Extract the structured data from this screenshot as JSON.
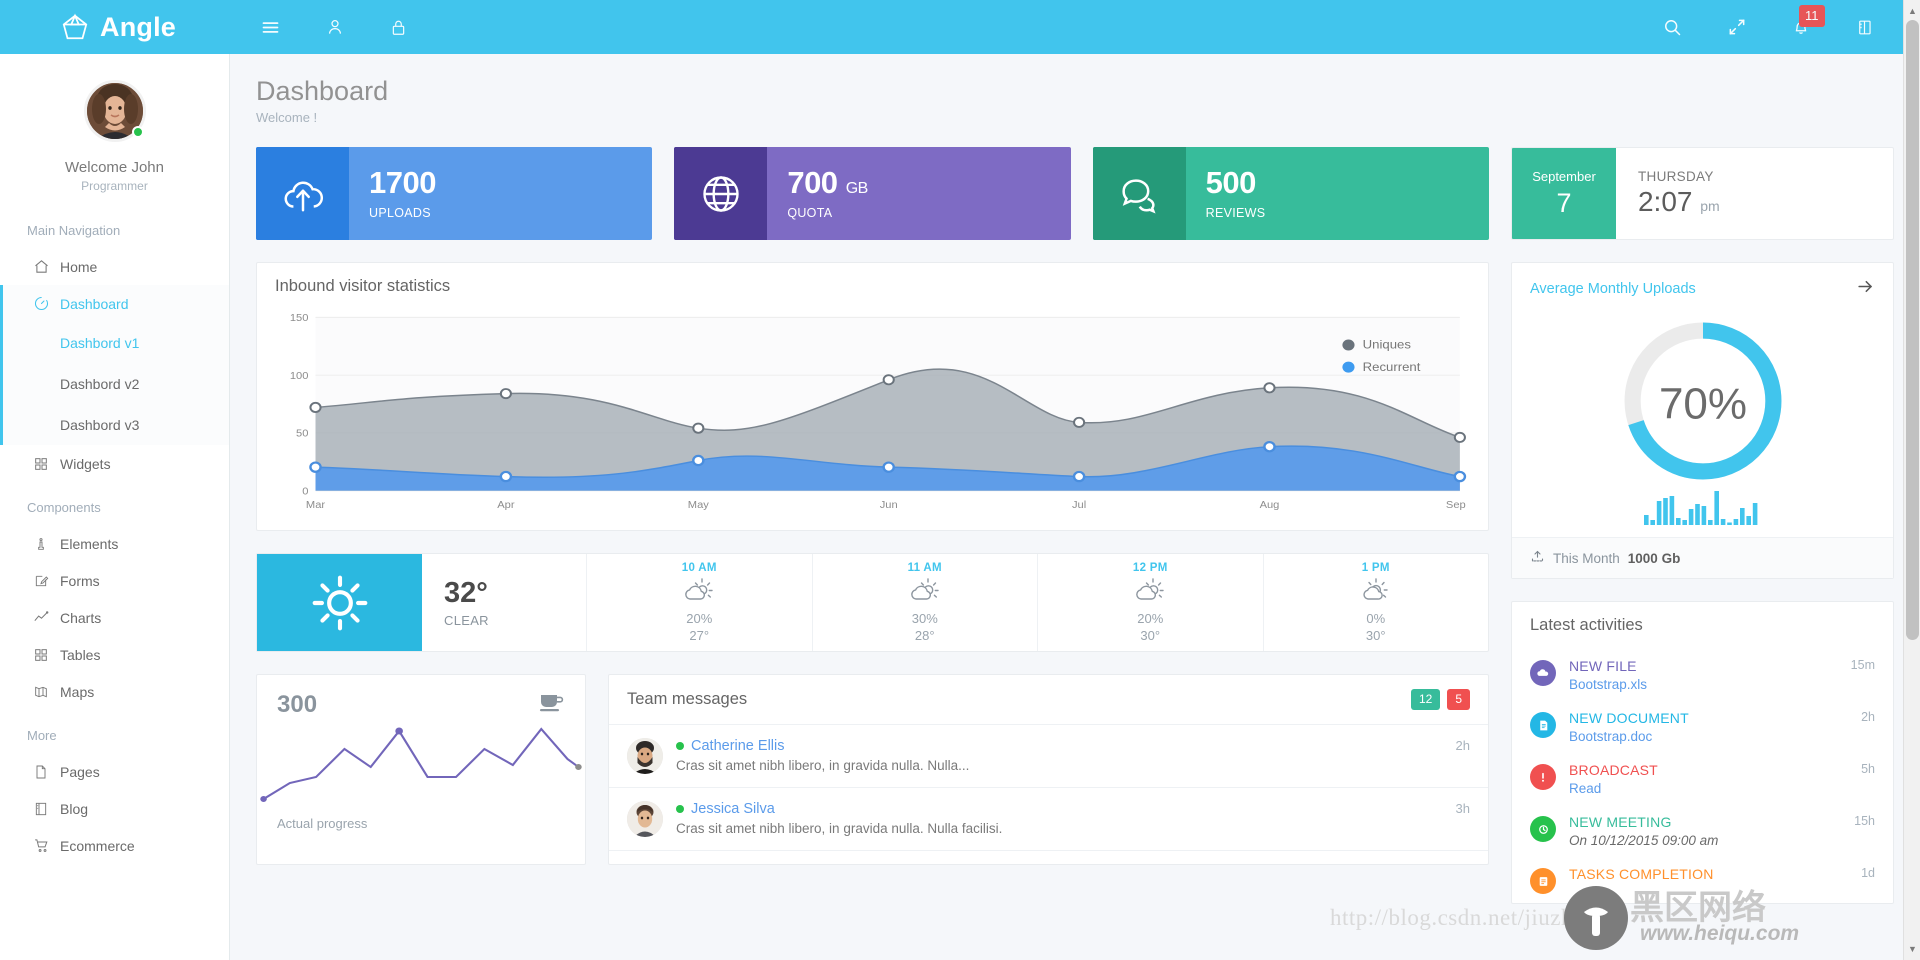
{
  "topbar": {
    "brand": "Angle",
    "left_icons": [
      {
        "name": "hamburger-menu-icon",
        "label": "Toggle navigation"
      },
      {
        "name": "user-icon",
        "label": "User"
      },
      {
        "name": "lock-icon",
        "label": "Lock screen"
      }
    ],
    "right_icons": [
      {
        "name": "search-icon",
        "label": "Search"
      },
      {
        "name": "fullscreen-icon",
        "label": "Fullscreen"
      },
      {
        "name": "bell-icon",
        "label": "Notifications"
      },
      {
        "name": "sidebar-toggle-icon",
        "label": "Offsidebar"
      }
    ],
    "notification_count": "11",
    "accent_color": "#41c5ed"
  },
  "sidebar": {
    "profile": {
      "name": "Welcome John",
      "role": "Programmer",
      "status": "online"
    },
    "sections": [
      {
        "heading": "Main Navigation",
        "items": [
          {
            "label": "Home",
            "icon": "home-icon",
            "active": false
          },
          {
            "label": "Dashboard",
            "icon": "gauge-icon",
            "active": true
          }
        ]
      }
    ],
    "submenu": [
      {
        "label": "Dashbord v1",
        "active": true
      },
      {
        "label": "Dashbord v2",
        "active": false
      },
      {
        "label": "Dashbord v3",
        "active": false
      }
    ],
    "after_submenu": [
      {
        "label": "Widgets",
        "icon": "grid-icon",
        "active": false
      }
    ],
    "components_heading": "Components",
    "components": [
      {
        "label": "Elements",
        "icon": "pin-icon"
      },
      {
        "label": "Forms",
        "icon": "pencil-square-icon"
      },
      {
        "label": "Charts",
        "icon": "line-chart-icon"
      },
      {
        "label": "Tables",
        "icon": "grid-icon"
      },
      {
        "label": "Maps",
        "icon": "map-icon"
      }
    ],
    "more_heading": "More",
    "more": [
      {
        "label": "Pages",
        "icon": "page-icon"
      },
      {
        "label": "Blog",
        "icon": "notebook-icon"
      },
      {
        "label": "Ecommerce",
        "icon": "cart-icon"
      }
    ]
  },
  "page": {
    "title": "Dashboard",
    "subtitle": "Welcome !"
  },
  "stats": [
    {
      "value": "1700",
      "unit": "",
      "label": "UPLOADS",
      "icon": "cloud-upload-icon",
      "theme": "sc-blue"
    },
    {
      "value": "700",
      "unit": "GB",
      "label": "QUOTA",
      "icon": "globe-icon",
      "theme": "sc-purple"
    },
    {
      "value": "500",
      "unit": "",
      "label": "REVIEWS",
      "icon": "chat-icon",
      "theme": "sc-green"
    }
  ],
  "date_card": {
    "month": "September",
    "day": "7",
    "weekday": "THURSDAY",
    "time": "2:07",
    "meridiem": "pm"
  },
  "visitor_panel": {
    "title": "Inbound visitor statistics"
  },
  "chart_data": {
    "type": "area",
    "title": "Inbound visitor statistics",
    "categories": [
      "Mar",
      "Apr",
      "May",
      "Jun",
      "Jul",
      "Aug",
      "Sep"
    ],
    "series": [
      {
        "name": "Uniques",
        "color": "#9aa4ad",
        "values": [
          72,
          84,
          60,
          96,
          72,
          84,
          60
        ]
      },
      {
        "name": "Recurrent",
        "color": "#5b9bea",
        "values": [
          20,
          12,
          26,
          20,
          12,
          38,
          12
        ]
      }
    ],
    "xlabel": "",
    "ylabel": "",
    "ylim": [
      0,
      150
    ],
    "yticks": [
      0,
      50,
      100,
      150
    ],
    "grid": true,
    "legend_position": "top-right",
    "stacked": true
  },
  "uploads_panel": {
    "title": "Average Monthly Uploads",
    "arrow_icon": "arrow-right-icon",
    "percent": "70%",
    "percent_value": 70,
    "donut_color": "#41c5ed",
    "donut_track": "#ebebeb",
    "footer_icon": "upload-icon",
    "footer_label": "This Month",
    "footer_value": "1000 Gb",
    "sparkline": [
      3,
      1,
      8,
      9,
      10,
      2,
      1,
      5,
      7,
      6,
      1,
      4,
      1,
      0,
      1,
      5,
      2,
      7
    ]
  },
  "weather": {
    "current": {
      "icon": "sun-icon",
      "temp": "32°",
      "condition": "CLEAR"
    },
    "hours": [
      {
        "label": "10 AM",
        "icon": "sun-cloud-icon",
        "precip": "20%",
        "temp": "27°"
      },
      {
        "label": "11 AM",
        "icon": "sun-cloud-icon",
        "precip": "30%",
        "temp": "28°"
      },
      {
        "label": "12 PM",
        "icon": "sun-cloud-icon",
        "precip": "20%",
        "temp": "30°"
      },
      {
        "label": "1 PM",
        "icon": "sun-cloud-icon",
        "precip": "0%",
        "temp": "30°"
      }
    ]
  },
  "progress_panel": {
    "value": "300",
    "icon": "coffee-cup-icon",
    "caption": "Actual progress",
    "line_color": "#7266ba",
    "points": [
      6,
      24,
      32,
      56,
      40,
      72,
      30,
      30,
      54,
      36,
      74,
      50,
      42
    ]
  },
  "messages_panel": {
    "title": "Team messages",
    "badges": [
      {
        "text": "12",
        "theme": "pill-green"
      },
      {
        "text": "5",
        "theme": "pill-red"
      }
    ],
    "items": [
      {
        "name": "Catherine Ellis",
        "status": "online",
        "text": "Cras sit amet nibh libero, in gravida nulla. Nulla...",
        "time": "2h",
        "avatar": "male-avatar-beard"
      },
      {
        "name": "Jessica Silva",
        "status": "online",
        "text": "Cras sit amet nibh libero, in gravida nulla. Nulla facilisi.",
        "time": "3h",
        "avatar": "male-avatar-short"
      }
    ]
  },
  "activities_panel": {
    "title": "Latest activities",
    "items": [
      {
        "title": "NEW FILE",
        "title_color": "#7266ba",
        "sub": "Bootstrap.xls",
        "sub_italic": false,
        "time": "15m",
        "icon": "cloud-upload-circle-icon",
        "icon_bg": "#7266ba"
      },
      {
        "title": "NEW DOCUMENT",
        "title_color": "#23b7e5",
        "sub": "Bootstrap.doc",
        "sub_italic": false,
        "time": "2h",
        "icon": "document-circle-icon",
        "icon_bg": "#23b7e5"
      },
      {
        "title": "BROADCAST",
        "title_color": "#f05050",
        "sub": "Read",
        "sub_italic": false,
        "time": "5h",
        "icon": "exclamation-circle-icon",
        "icon_bg": "#f05050"
      },
      {
        "title": "NEW MEETING",
        "title_color": "#37bc9b",
        "sub": "On 10/12/2015 09:00 am",
        "sub_italic": true,
        "time": "15h",
        "icon": "clock-circle-icon",
        "icon_bg": "#27c24c"
      },
      {
        "title": "TASKS COMPLETION",
        "title_color": "#ff902b",
        "sub": "",
        "sub_italic": false,
        "time": "1d",
        "icon": "list-circle-icon",
        "icon_bg": "#ff902b"
      }
    ]
  },
  "watermark": {
    "url": "http://blog.csdn.net/jiuzhehei",
    "cn_text": "黑区网络",
    "site": "www.heiqu.com"
  }
}
